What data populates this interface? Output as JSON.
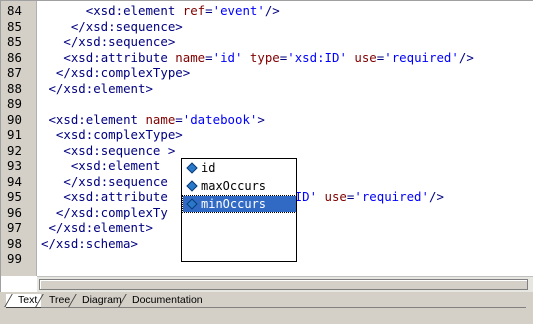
{
  "editor": {
    "lines": [
      {
        "n": "84",
        "segs": [
          [
            "",
            "      "
          ],
          [
            "tag",
            "<xsd:element "
          ],
          [
            "attr",
            "ref"
          ],
          [
            "tag",
            "="
          ],
          [
            "val",
            "'event'"
          ],
          [
            "tag",
            "/>"
          ]
        ]
      },
      {
        "n": "85",
        "segs": [
          [
            "",
            "    "
          ],
          [
            "tag",
            "</xsd:sequence>"
          ]
        ]
      },
      {
        "n": "85",
        "segs": [
          [
            "",
            "   "
          ],
          [
            "tag",
            "</xsd:sequence>"
          ]
        ]
      },
      {
        "n": "86",
        "segs": [
          [
            "",
            "   "
          ],
          [
            "tag",
            "<xsd:attribute "
          ],
          [
            "attr",
            "name"
          ],
          [
            "tag",
            "="
          ],
          [
            "val",
            "'id'"
          ],
          [
            "tag",
            " "
          ],
          [
            "attr",
            "type"
          ],
          [
            "tag",
            "="
          ],
          [
            "val",
            "'xsd:ID'"
          ],
          [
            "tag",
            " "
          ],
          [
            "attr",
            "use"
          ],
          [
            "tag",
            "="
          ],
          [
            "val",
            "'required'"
          ],
          [
            "tag",
            "/>"
          ]
        ]
      },
      {
        "n": "87",
        "segs": [
          [
            "",
            "  "
          ],
          [
            "tag",
            "</xsd:complexType>"
          ]
        ]
      },
      {
        "n": "88",
        "segs": [
          [
            "",
            " "
          ],
          [
            "tag",
            "</xsd:element>"
          ]
        ]
      },
      {
        "n": "89",
        "segs": []
      },
      {
        "n": "90",
        "segs": [
          [
            "",
            " "
          ],
          [
            "tag",
            "<xsd:element "
          ],
          [
            "attr",
            "name"
          ],
          [
            "tag",
            "="
          ],
          [
            "val",
            "'datebook'"
          ],
          [
            "tag",
            ">"
          ]
        ]
      },
      {
        "n": "91",
        "segs": [
          [
            "",
            "  "
          ],
          [
            "tag",
            "<xsd:complexType>"
          ]
        ]
      },
      {
        "n": "92",
        "segs": [
          [
            "",
            "   "
          ],
          [
            "tag",
            "<xsd:sequence >"
          ]
        ]
      },
      {
        "n": "93",
        "segs": [
          [
            "",
            "    "
          ],
          [
            "tag",
            "<xsd:element "
          ],
          [
            "",
            "             "
          ],
          [
            "tag",
            "/>"
          ]
        ]
      },
      {
        "n": "94",
        "segs": [
          [
            "",
            "   "
          ],
          [
            "tag",
            "</xsd:sequence"
          ]
        ]
      },
      {
        "n": "95",
        "segs": [
          [
            "",
            "   "
          ],
          [
            "tag",
            "<xsd:attribute"
          ],
          [
            "",
            "           "
          ],
          [
            "tag",
            "="
          ],
          [
            "val",
            "'xsd:ID'"
          ],
          [
            "tag",
            " "
          ],
          [
            "attr",
            "use"
          ],
          [
            "tag",
            "="
          ],
          [
            "val",
            "'required'"
          ],
          [
            "tag",
            "/>"
          ]
        ]
      },
      {
        "n": "96",
        "segs": [
          [
            "",
            "  "
          ],
          [
            "tag",
            "</xsd:complexTy"
          ]
        ]
      },
      {
        "n": "97",
        "segs": [
          [
            "",
            " "
          ],
          [
            "tag",
            "</xsd:element>"
          ]
        ]
      },
      {
        "n": "98",
        "segs": [
          [
            "tag",
            "</xsd:schema>"
          ]
        ]
      },
      {
        "n": "99",
        "segs": []
      }
    ]
  },
  "autocomplete": {
    "options": [
      "id",
      "maxOccurs",
      "minOccurs"
    ],
    "selected": "minOccurs",
    "icon": "xml-attribute-icon"
  },
  "tabs": {
    "items": [
      "Text",
      "Tree",
      "Diagram",
      "Documentation"
    ],
    "active": "Text"
  },
  "colors": {
    "tag": "#000080",
    "attribute": "#800000",
    "value": "#0000ff",
    "selection": "#316ac5"
  }
}
